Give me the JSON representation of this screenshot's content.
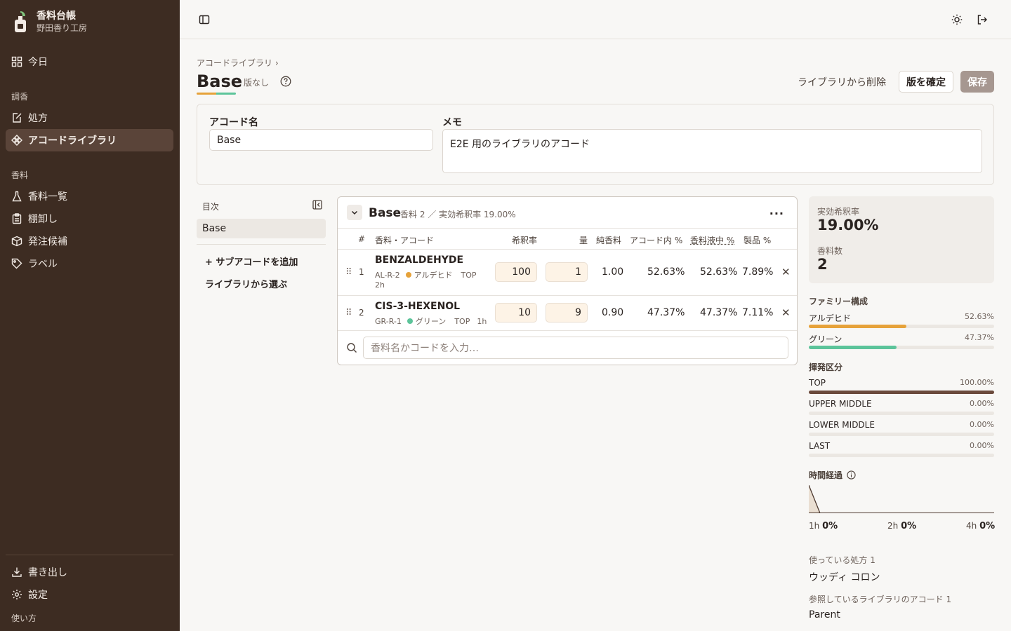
{
  "app": {
    "name": "香料台帳",
    "workspace": "野田香り工房"
  },
  "sidebar": {
    "today": "今日",
    "section_blend": "調香",
    "prescription": "処方",
    "accord_library": "アコードライブラリ",
    "section_material": "香料",
    "material_list": "香料一覧",
    "stocktake": "棚卸し",
    "reorder": "発注候補",
    "labels": "ラベル",
    "export": "書き出し",
    "settings": "設定",
    "howto": "使い方"
  },
  "header": {
    "breadcrumb": "アコードライブラリ ›",
    "title": "Base",
    "version": "版なし",
    "remove_from_library": "ライブラリから削除",
    "confirm_version": "版を確定",
    "save": "保存"
  },
  "form": {
    "name_label": "アコード名",
    "name_value": "Base",
    "memo_label": "メモ",
    "memo_value": "E2E 用のライブラリのアコード"
  },
  "toc": {
    "title": "目次",
    "item": "Base",
    "add_sub": "+ サブアコードを追加",
    "pick_library": "ライブラリから選ぶ"
  },
  "panel": {
    "title": "Base",
    "meta": "香料 2 ／ 実効希釈率 19.00%",
    "columns": [
      "#",
      "香料・アコード",
      "希釈率",
      "量",
      "純香料",
      "アコード内 %",
      "香料液中 %",
      "製品 %"
    ],
    "rows": [
      {
        "n": "1",
        "name": "BENZALDEHYDE",
        "code": "AL-R-2",
        "family": "アルデヒド",
        "note": "TOP",
        "time": "2h",
        "dilution": "100",
        "amount": "1",
        "pure": "1.00",
        "in_accord": "52.63%",
        "in_liquid": "52.63%",
        "product": "7.89%",
        "color": "#e6a23a"
      },
      {
        "n": "2",
        "name": "CIS-3-HEXENOL",
        "code": "GR-R-1",
        "family": "グリーン",
        "note": "TOP",
        "time": "1h",
        "dilution": "10",
        "amount": "9",
        "pure": "0.90",
        "in_accord": "47.37%",
        "in_liquid": "47.37%",
        "product": "7.11%",
        "color": "#5cc49a"
      }
    ],
    "search_placeholder": "香料名かコードを入力…"
  },
  "stats": {
    "eff_dilution_label": "実効希釈率",
    "eff_dilution": "19.00%",
    "count_label": "香料数",
    "count": "2"
  },
  "family": {
    "label": "ファミリー構成",
    "items": [
      {
        "name": "アルデヒド",
        "pct": "52.63%",
        "value": 52.63,
        "color": "#e6a23a"
      },
      {
        "name": "グリーン",
        "pct": "47.37%",
        "value": 47.37,
        "color": "#5cc49a"
      }
    ]
  },
  "volatility": {
    "label": "揮発区分",
    "items": [
      {
        "name": "TOP",
        "pct": "100.00%",
        "value": 100,
        "color": "#6b4a3c"
      },
      {
        "name": "UPPER MIDDLE",
        "pct": "0.00%",
        "value": 0,
        "color": "#6b4a3c"
      },
      {
        "name": "LOWER MIDDLE",
        "pct": "0.00%",
        "value": 0,
        "color": "#6b4a3c"
      },
      {
        "name": "LAST",
        "pct": "0.00%",
        "value": 0,
        "color": "#6b4a3c"
      }
    ]
  },
  "timeline": {
    "label": "時間経過",
    "ticks": [
      {
        "t": "1h",
        "v": "0%"
      },
      {
        "t": "2h",
        "v": "0%"
      },
      {
        "t": "4h",
        "v": "0%"
      }
    ]
  },
  "used_in": {
    "label": "使っている処方 1",
    "value": "ウッディ コロン"
  },
  "refs": {
    "label": "参照しているライブラリのアコード 1",
    "value": "Parent"
  }
}
